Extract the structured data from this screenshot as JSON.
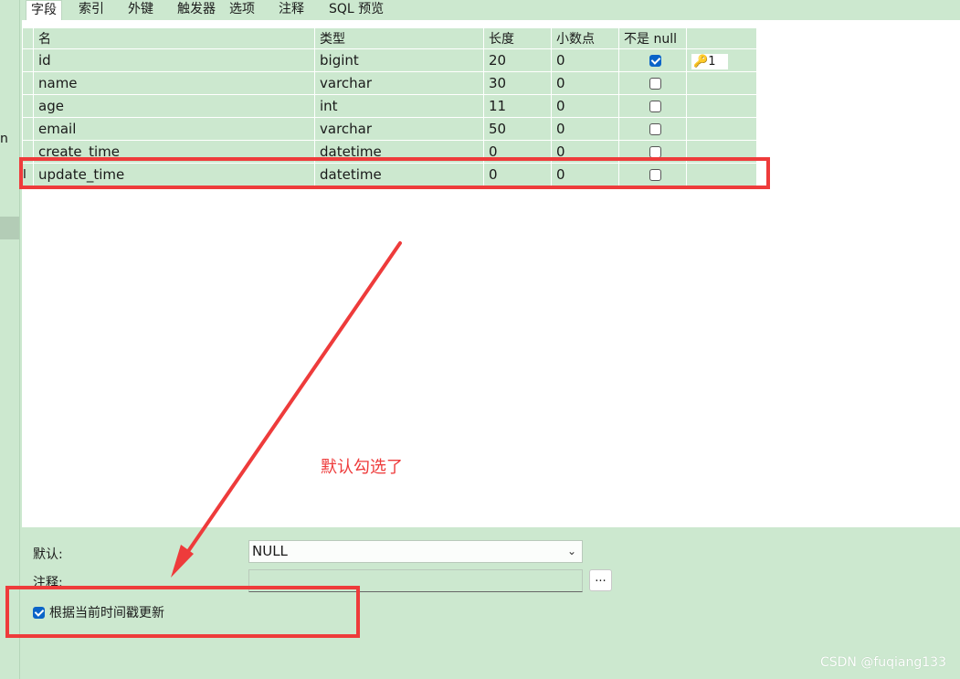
{
  "tabs": [
    {
      "label": "字段",
      "active": true
    },
    {
      "label": "索引",
      "active": false
    },
    {
      "label": "外键",
      "active": false
    },
    {
      "label": "触发器",
      "active": false
    },
    {
      "label": "选项",
      "active": false
    },
    {
      "label": "注释",
      "active": false
    },
    {
      "label": "SQL 预览",
      "active": false
    }
  ],
  "left_panel": {
    "fragment": "n"
  },
  "fields_grid": {
    "columns": [
      "名",
      "类型",
      "长度",
      "小数点",
      "不是 null",
      ""
    ],
    "rows": [
      {
        "name": "id",
        "type": "bigint",
        "length": "20",
        "decimals": "0",
        "not_null": true,
        "key": "1"
      },
      {
        "name": "name",
        "type": "varchar",
        "length": "30",
        "decimals": "0",
        "not_null": false,
        "key": ""
      },
      {
        "name": "age",
        "type": "int",
        "length": "11",
        "decimals": "0",
        "not_null": false,
        "key": ""
      },
      {
        "name": "email",
        "type": "varchar",
        "length": "50",
        "decimals": "0",
        "not_null": false,
        "key": ""
      },
      {
        "name": "create_time",
        "type": "datetime",
        "length": "0",
        "decimals": "0",
        "not_null": false,
        "key": ""
      },
      {
        "name": "update_time",
        "type": "datetime",
        "length": "0",
        "decimals": "0",
        "not_null": false,
        "key": "",
        "selected": true
      }
    ],
    "row_indicator": "I"
  },
  "properties": {
    "default_label": "默认:",
    "default_value": "NULL",
    "comment_label": "注释:",
    "comment_value": "",
    "dots_label": "...",
    "on_update_label": "根据当前时间戳更新",
    "on_update_checked": true
  },
  "annotation": {
    "text": "默认勾选了",
    "color": "#ee3b3b"
  },
  "watermark": "CSDN @fuqiang133",
  "colors": {
    "background": "#cce8cf",
    "highlight": "#ee3b3b",
    "checkbox": "#0a64c8"
  },
  "icons": [
    "key-icon",
    "chevron-down-icon",
    "checkbox-icon",
    "text-cursor-icon"
  ]
}
